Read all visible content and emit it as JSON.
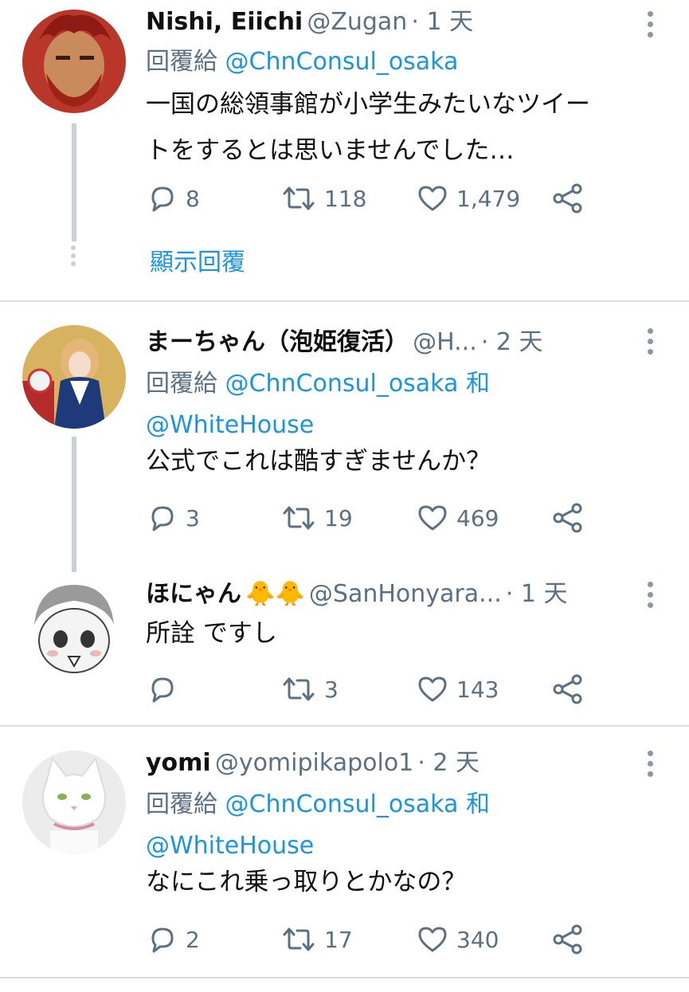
{
  "tweets": [
    {
      "name": "Nishi, Eiichi",
      "handle": "@Zugan",
      "time": "· 1 天",
      "reply_prefix": "回覆給",
      "reply_to": "@ChnConsul_osaka",
      "text_line1": "一国の総領事館が小学生みたいなツイー",
      "text_line2": "トをするとは思いませんでした…",
      "replies": "8",
      "retweets": "118",
      "likes": "1,479",
      "show_replies": "顯示回覆"
    },
    {
      "name": "まーちゃん（泡姫復活）",
      "handle": "@H...",
      "time": "· 2 天",
      "reply_prefix": "回覆給",
      "reply_to": "@ChnConsul_osaka",
      "reply_and": "和",
      "reply_to2": "@WhiteHouse",
      "text_line1": "公式でこれは酷すぎませんか？",
      "replies": "3",
      "retweets": "19",
      "likes": "469"
    },
    {
      "name": "ほにゃん",
      "emoji": "🐥🐥",
      "handle": "@SanHonyara...",
      "time": "· 1 天",
      "text_line1": "所詮 ですし",
      "replies": "",
      "retweets": "3",
      "likes": "143"
    },
    {
      "name": "yomi",
      "handle": "@yomipikapolo1",
      "time": "· 2 天",
      "reply_prefix": "回覆給",
      "reply_to": "@ChnConsul_osaka",
      "reply_and": "和",
      "reply_to2": "@WhiteHouse",
      "text_line1": "なにこれ乗っ取りとかなの？",
      "replies": "2",
      "retweets": "17",
      "likes": "340"
    }
  ],
  "icons": [
    "reply-icon",
    "retweet-icon",
    "like-icon",
    "share-icon",
    "more-icon"
  ],
  "colors": {
    "link": "#1b95e0",
    "muted": "#5b7083",
    "thread": "#c9d1d8"
  }
}
